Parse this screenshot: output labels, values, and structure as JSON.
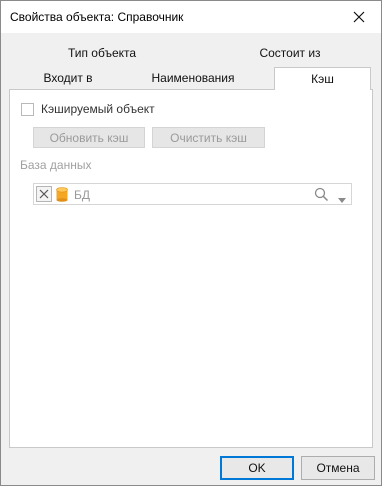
{
  "window": {
    "title": "Свойства объекта: Справочник"
  },
  "tabs": {
    "row1": [
      {
        "label": "Тип объекта"
      },
      {
        "label": "Состоит из"
      }
    ],
    "row2": [
      {
        "label": "Входит в"
      },
      {
        "label": "Наименования"
      },
      {
        "label": "Кэш",
        "active": true
      }
    ]
  },
  "cache": {
    "checkbox_label": "Кэшируемый объект",
    "checked": false,
    "refresh_button": "Обновить кэш",
    "clear_button": "Очистить кэш"
  },
  "database": {
    "section_label": "База данных",
    "value": "БД",
    "icon": "database-icon"
  },
  "footer": {
    "ok_label": "OK",
    "cancel_label": "Отмена"
  },
  "colors": {
    "accent": "#0078d7",
    "db_icon": "#f5a623",
    "disabled_text": "#9a9a9a"
  }
}
